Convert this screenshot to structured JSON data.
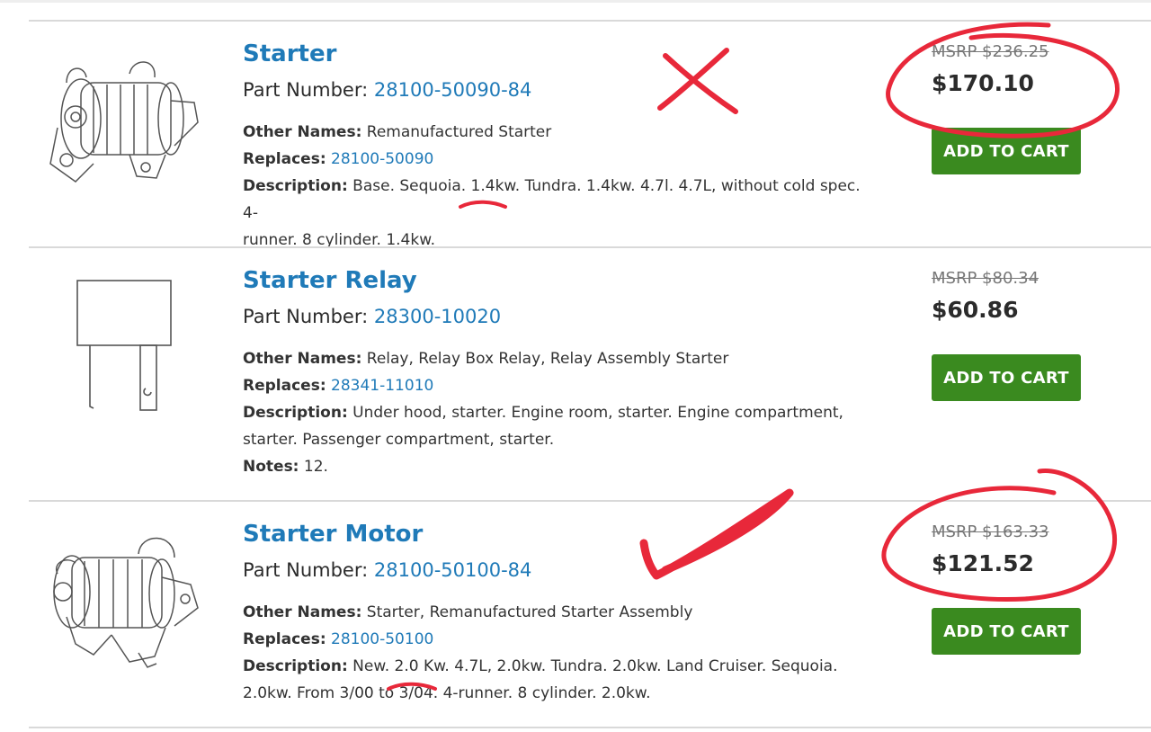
{
  "list_divider_color": "#d9d9d9",
  "accent_color": "#1f7ab8",
  "button_color": "#3a8a1f",
  "annotation_color": "#e8283a",
  "parts": [
    {
      "title": "Starter",
      "part_number_label": "Part Number:",
      "part_number": "28100-50090-84",
      "other_names_label": "Other Names:",
      "other_names": "Remanufactured Starter",
      "replaces_label": "Replaces:",
      "replaces": "28100-50090",
      "description_label": "Description:",
      "description_line1": "Base. Sequoia. 1.4kw. Tundra. 1.4kw. 4.7l. 4.7L, without cold spec. 4-",
      "description_line2": "runner. 8 cylinder. 1.4kw.",
      "msrp": "MSRP $236.25",
      "price": "$170.10",
      "button_label": "ADD TO CART",
      "image_icon": "starter-icon"
    },
    {
      "title": "Starter Relay",
      "part_number_label": "Part Number:",
      "part_number": "28300-10020",
      "other_names_label": "Other Names:",
      "other_names": "Relay, Relay Box Relay, Relay Assembly Starter",
      "replaces_label": "Replaces:",
      "replaces": "28341-11010",
      "description_label": "Description:",
      "description_line1": "Under hood, starter. Engine room, starter. Engine compartment,",
      "description_line2": "starter. Passenger compartment, starter.",
      "notes_label": "Notes:",
      "notes": "12.",
      "msrp": "MSRP $80.34",
      "price": "$60.86",
      "button_label": "ADD TO CART",
      "image_icon": "relay-icon"
    },
    {
      "title": "Starter Motor",
      "part_number_label": "Part Number:",
      "part_number": "28100-50100-84",
      "other_names_label": "Other Names:",
      "other_names": "Starter, Remanufactured Starter Assembly",
      "replaces_label": "Replaces:",
      "replaces": "28100-50100",
      "description_label": "Description:",
      "description_line1": "New. 2.0 Kw. 4.7L, 2.0kw. Tundra. 2.0kw. Land Cruiser. Sequoia.",
      "description_line2": "2.0kw. From 3/00 to 3/04. 4-runner. 8 cylinder. 2.0kw.",
      "msrp": "MSRP $163.33",
      "price": "$121.52",
      "button_label": "ADD TO CART",
      "image_icon": "starter-motor-icon"
    }
  ]
}
